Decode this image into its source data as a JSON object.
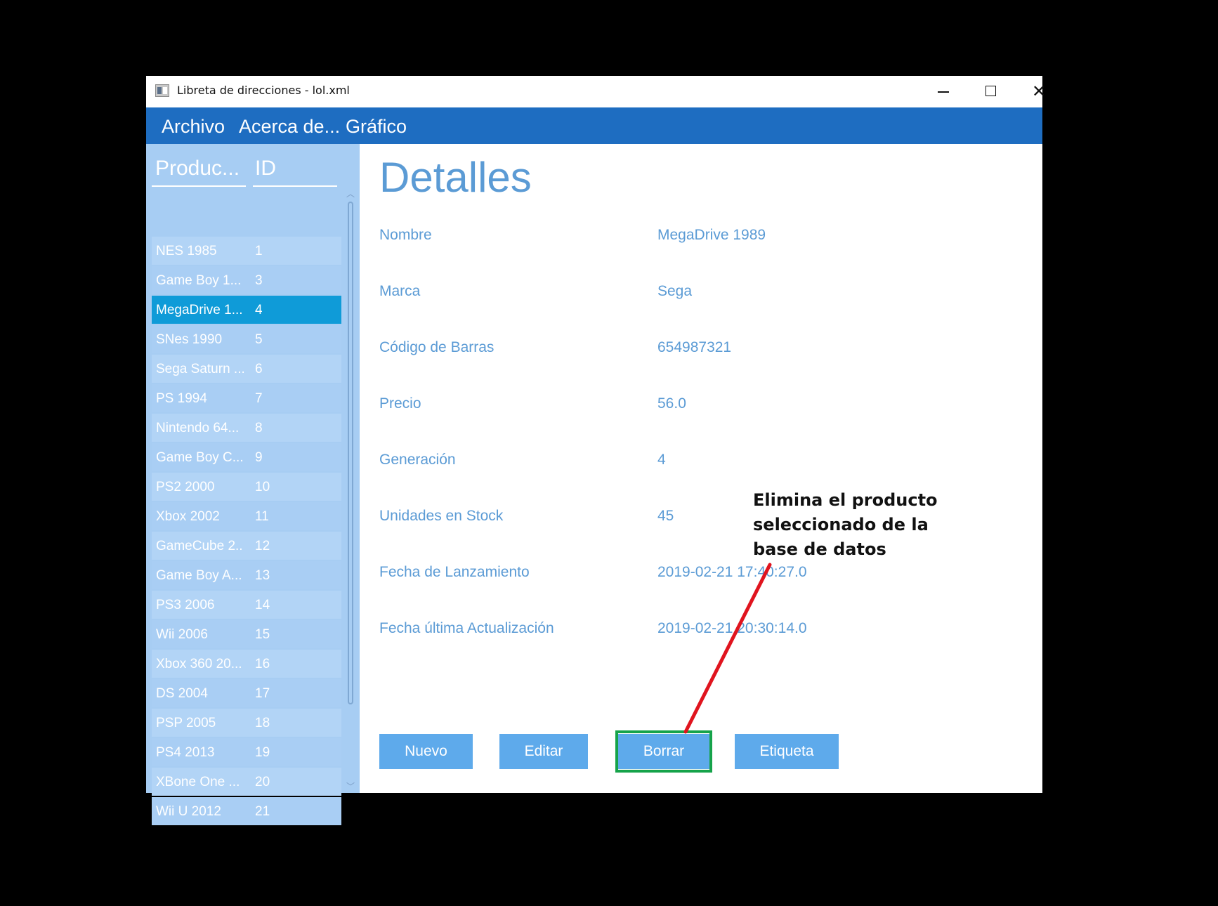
{
  "window": {
    "title": "Libreta de direcciones - lol.xml",
    "controls": {
      "minimize": "—",
      "maximize": "□",
      "close": "✕"
    }
  },
  "menu": {
    "items": [
      "Archivo",
      "Acerca de...",
      "Gráfico"
    ]
  },
  "product_list": {
    "columns": [
      "Produc...",
      "ID"
    ],
    "rows": [
      {
        "name": "NES 1985",
        "id": "1"
      },
      {
        "name": "Game Boy 1...",
        "id": "3"
      },
      {
        "name": "MegaDrive 1...",
        "id": "4"
      },
      {
        "name": "SNes 1990",
        "id": "5"
      },
      {
        "name": "Sega Saturn ...",
        "id": "6"
      },
      {
        "name": "PS 1994",
        "id": "7"
      },
      {
        "name": "Nintendo 64...",
        "id": "8"
      },
      {
        "name": "Game Boy C...",
        "id": "9"
      },
      {
        "name": "PS2 2000",
        "id": "10"
      },
      {
        "name": "Xbox 2002",
        "id": "11"
      },
      {
        "name": "GameCube 2...",
        "id": "12"
      },
      {
        "name": "Game Boy A...",
        "id": "13"
      },
      {
        "name": "PS3 2006",
        "id": "14"
      },
      {
        "name": "Wii 2006",
        "id": "15"
      },
      {
        "name": "Xbox 360 20...",
        "id": "16"
      },
      {
        "name": "DS 2004",
        "id": "17"
      },
      {
        "name": "PSP 2005",
        "id": "18"
      },
      {
        "name": "PS4 2013",
        "id": "19"
      },
      {
        "name": "XBone One ...",
        "id": "20"
      },
      {
        "name": "Wii U 2012",
        "id": "21"
      }
    ],
    "selected_index": 2,
    "scroll_up_icon": "chevron-up-icon",
    "scroll_down_icon": "chevron-down-icon"
  },
  "details": {
    "title": "Detalles",
    "fields": [
      {
        "label": "Nombre",
        "value": "MegaDrive 1989"
      },
      {
        "label": "Marca",
        "value": "Sega"
      },
      {
        "label": "Código de Barras",
        "value": "654987321"
      },
      {
        "label": "Precio",
        "value": "56.0"
      },
      {
        "label": "Generación",
        "value": "4"
      },
      {
        "label": "Unidades en Stock",
        "value": "45"
      },
      {
        "label": "Fecha de Lanzamiento",
        "value": "2019-02-21 17:40:27.0"
      },
      {
        "label": "Fecha última Actualización",
        "value": "2019-02-21 20:30:14.0"
      }
    ]
  },
  "buttons": {
    "nuevo": "Nuevo",
    "editar": "Editar",
    "borrar": "Borrar",
    "etiqueta": "Etiqueta"
  },
  "annotation": {
    "lines": [
      "Elimina el producto",
      "seleccionado de la",
      "base de datos"
    ],
    "arrow_color": "#e0141e",
    "highlight_color": "#16a34a"
  },
  "colors": {
    "menubar": "#1e6dc1",
    "list_background": "#a7cdf3",
    "selected_row": "#0f9bd8",
    "accent_text": "#5b9bd5",
    "button": "#5eaaeb"
  }
}
